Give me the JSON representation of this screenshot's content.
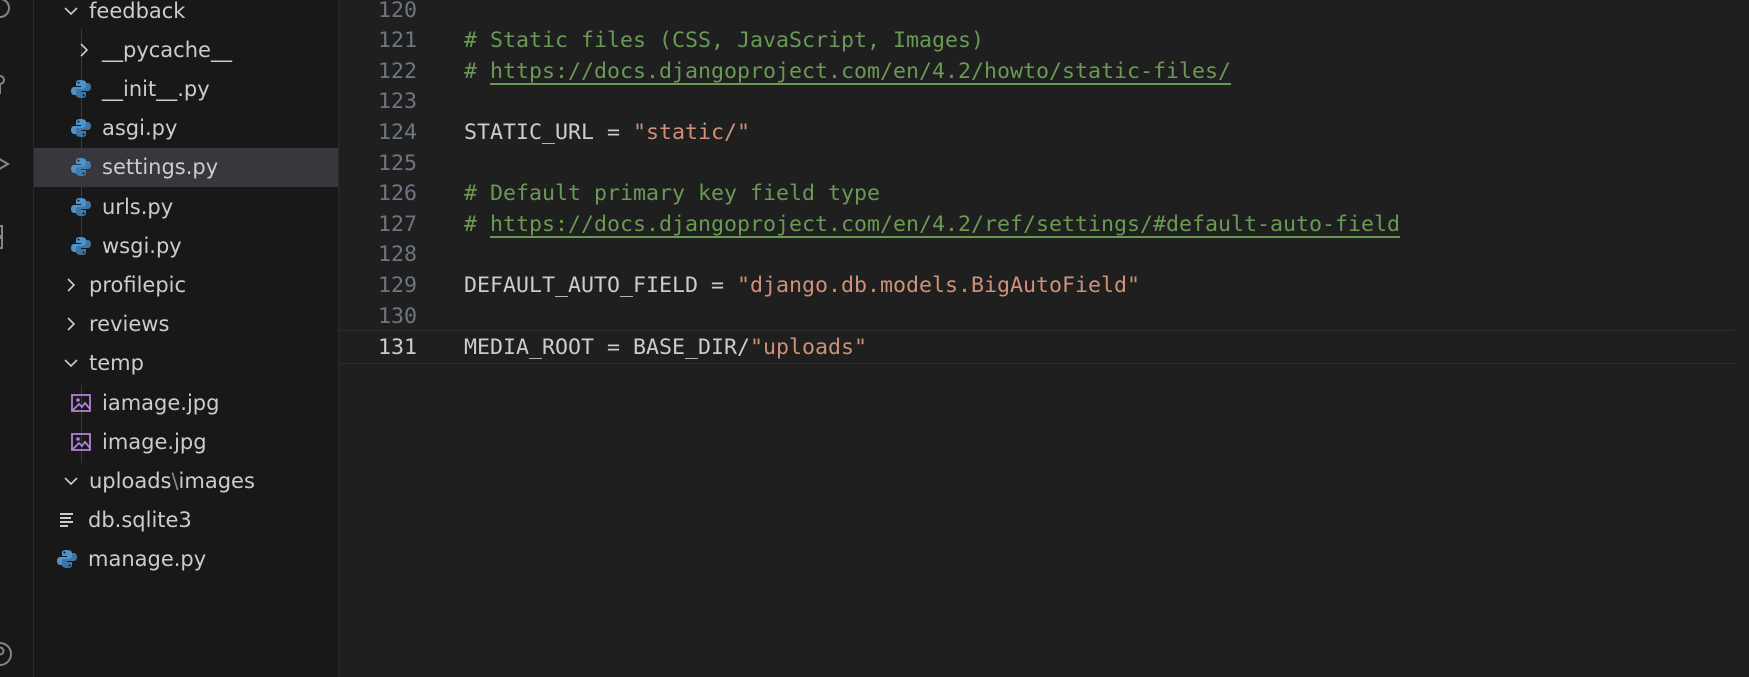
{
  "explorer": {
    "rows": [
      {
        "label": "feedback",
        "type": "folder-open",
        "icon": "chevron-down-icon"
      },
      {
        "label": "__pycache__",
        "type": "folder-closed",
        "icon": "chevron-right-icon"
      },
      {
        "label": "__init__.py",
        "type": "python",
        "icon": "python-icon"
      },
      {
        "label": "asgi.py",
        "type": "python",
        "icon": "python-icon"
      },
      {
        "label": "settings.py",
        "type": "python",
        "icon": "python-icon"
      },
      {
        "label": "urls.py",
        "type": "python",
        "icon": "python-icon"
      },
      {
        "label": "wsgi.py",
        "type": "python",
        "icon": "python-icon"
      },
      {
        "label": "profilepic",
        "type": "folder-closed",
        "icon": "chevron-right-icon"
      },
      {
        "label": "reviews",
        "type": "folder-closed",
        "icon": "chevron-right-icon"
      },
      {
        "label": "temp",
        "type": "folder-open",
        "icon": "chevron-down-icon"
      },
      {
        "label": "iamage.jpg",
        "type": "image",
        "icon": "image-file-icon"
      },
      {
        "label": "image.jpg",
        "type": "image",
        "icon": "image-file-icon"
      },
      {
        "label_a": "uploads",
        "label_sep": "\\",
        "label_b": "images",
        "type": "folder-open",
        "icon": "chevron-down-icon"
      },
      {
        "label": "db.sqlite3",
        "type": "text",
        "icon": "text-file-icon"
      },
      {
        "label": "manage.py",
        "type": "python",
        "icon": "python-icon"
      }
    ],
    "selected": "settings.py"
  },
  "editor": {
    "lines": [
      {
        "num": "120",
        "parts": []
      },
      {
        "num": "121",
        "parts": [
          {
            "t": "# Static files (CSS, JavaScript, Images)",
            "k": "comment"
          }
        ]
      },
      {
        "num": "122",
        "parts": [
          {
            "t": "# ",
            "k": "comment"
          },
          {
            "t": "https://docs.djangoproject.com/en/4.2/howto/static-files/",
            "k": "link"
          }
        ]
      },
      {
        "num": "123",
        "parts": []
      },
      {
        "num": "124",
        "parts": [
          {
            "t": "STATIC_URL = ",
            "k": "plain"
          },
          {
            "t": "\"static/\"",
            "k": "string"
          }
        ]
      },
      {
        "num": "125",
        "parts": []
      },
      {
        "num": "126",
        "parts": [
          {
            "t": "# Default primary key field type",
            "k": "comment"
          }
        ]
      },
      {
        "num": "127",
        "parts": [
          {
            "t": "# ",
            "k": "comment"
          },
          {
            "t": "https://docs.djangoproject.com/en/4.2/ref/settings/#default-auto-field",
            "k": "link"
          }
        ]
      },
      {
        "num": "128",
        "parts": []
      },
      {
        "num": "129",
        "parts": [
          {
            "t": "DEFAULT_AUTO_FIELD = ",
            "k": "plain"
          },
          {
            "t": "\"django.db.models.BigAutoField\"",
            "k": "string"
          }
        ]
      },
      {
        "num": "130",
        "parts": []
      },
      {
        "num": "131",
        "parts": [
          {
            "t": "MEDIA_ROOT = BASE_DIR/",
            "k": "plain"
          },
          {
            "t": "\"uploads\"",
            "k": "string"
          }
        ]
      }
    ],
    "current_line": "131"
  },
  "colors": {
    "comment": "#6a9955",
    "string": "#ce9178",
    "python_icon": "#4b94d0",
    "image_icon": "#b180d7"
  }
}
